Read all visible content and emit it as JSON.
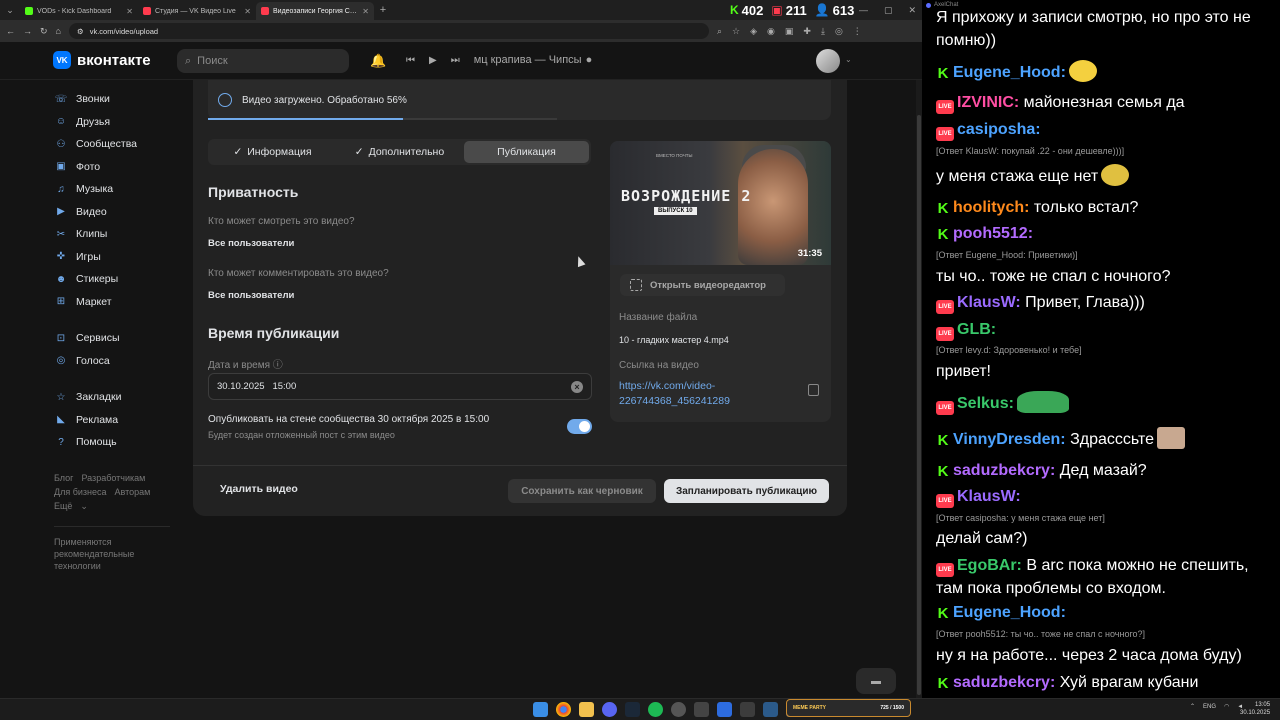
{
  "browser": {
    "tabs": [
      {
        "label": "VODs - Kick Dashboard",
        "color": "#53fc18"
      },
      {
        "label": "Студия — VK Видео Live",
        "color": "#ff3b4e"
      },
      {
        "label": "Видеозаписи Георгия Смида",
        "color": "#ff3b4e"
      }
    ],
    "url": "vk.com/video/upload"
  },
  "stream_stats": {
    "kick_viewers": "402",
    "live_viewers": "211",
    "total": "613"
  },
  "vk": {
    "logo": "вконтакте",
    "logo_badge": "VK",
    "search_placeholder": "Поиск",
    "now_playing": "мц крапива — Чипсы"
  },
  "sidebar": {
    "group1": [
      "Звонки",
      "Друзья",
      "Сообщества",
      "Фото",
      "Музыка",
      "Видео",
      "Клипы",
      "Игры",
      "Стикеры",
      "Маркет"
    ],
    "group2": [
      "Сервисы",
      "Голоса"
    ],
    "group3": [
      "Закладки",
      "Реклама",
      "Помощь"
    ],
    "footer": {
      "blog": "Блог",
      "devs": "Разработчикам",
      "business": "Для бизнеса",
      "authors": "Авторам",
      "more": "Ещё"
    },
    "recommend_note": "Применяются рекомендательные технологии"
  },
  "upload": {
    "status": "Видео загружено. Обработано 56%",
    "progress_percent": 56,
    "tabs": [
      "Информация",
      "Дополнительно",
      "Публикация"
    ]
  },
  "privacy": {
    "heading": "Приватность",
    "who_watch_label": "Кто может смотреть это видео?",
    "who_watch_value": "Все пользователи",
    "who_comment_label": "Кто может комментировать это видео?",
    "who_comment_value": "Все пользователи"
  },
  "publish_time": {
    "heading": "Время публикации",
    "datetime_label": "Дата и время",
    "datetime_value": "30.10.2025   15:00",
    "wall_post": "Опубликовать на стене сообщества 30 октября 2025 в 15:00",
    "wall_post_sub": "Будет создан отложенный пост с этим видео",
    "wall_toggle_on": true
  },
  "preview": {
    "thumb_title": "ВОЗРОЖДЕНИЕ 2",
    "thumb_episode": "ВЫПУСК 10",
    "thumb_brand": "ВМЕСТО ПОЧТЫ",
    "duration": "31:35",
    "editor_button": "Открыть видеоредактор",
    "filename_label": "Название файла",
    "filename": "10 - гладких мастер 4.mp4",
    "link_label": "Ссылка на видео",
    "link_line1": "https://vk.com/video-",
    "link_line2": "226744368_456241289"
  },
  "actions": {
    "delete": "Удалить видео",
    "draft": "Сохранить как черновик",
    "schedule": "Запланировать публикацию"
  },
  "chat": {
    "app_title": "AxelChat",
    "messages": [
      {
        "platform": "",
        "nick": "",
        "color": "",
        "text": "Я прихожу и записи смотрю, но про это не помню))"
      },
      {
        "platform": "kick",
        "nick": "Eugene_Hood:",
        "color": "#4da3ff",
        "text": ""
      },
      {
        "platform": "live",
        "nick": "IZVINIC:",
        "color": "#ff4ea3",
        "text": "майонезная семья да"
      },
      {
        "platform": "live",
        "nick": "casiposha:",
        "color": "#4da3ff",
        "reply": "[Ответ KlausW: покупай .22 - они дешевле)))]",
        "text": "у меня стажа еще нет"
      },
      {
        "platform": "kick",
        "nick": "hoolitych:",
        "color": "#ff8a1c",
        "text": "только встал?"
      },
      {
        "platform": "kick",
        "nick": "pooh5512:",
        "color": "#b36bff",
        "reply": "[Ответ Eugene_Hood: Приветики)]",
        "text": "ты чо.. тоже не спал с ночного?"
      },
      {
        "platform": "live",
        "nick": "KlausW:",
        "color": "#9b6bff",
        "text": "Привет, Глава)))"
      },
      {
        "platform": "live",
        "nick": "GLB:",
        "color": "#39c86a",
        "reply": "[Ответ levy.d: Здоровенько! и тебе]",
        "text": "привет!"
      },
      {
        "platform": "live",
        "nick": "Selkus:",
        "color": "#39c86a",
        "text": ""
      },
      {
        "platform": "kick",
        "nick": "VinnyDresden:",
        "color": "#4da3ff",
        "text": "Здрасссьте"
      },
      {
        "platform": "kick",
        "nick": "saduzbekcry:",
        "color": "#b36bff",
        "text": "Дед мазай?"
      },
      {
        "platform": "live",
        "nick": "KlausW:",
        "color": "#9b6bff",
        "reply": "[Ответ casiposha: у меня стажа еще нет]",
        "text": "делай сам?)"
      },
      {
        "platform": "live",
        "nick": "EgoBAr:",
        "color": "#39c86a",
        "text": "В arc пока можно не спешить, там пока проблемы со входом."
      },
      {
        "platform": "kick",
        "nick": "Eugene_Hood:",
        "color": "#4da3ff",
        "reply": "[Ответ pooh5512: ты чо.. тоже не спал с ночного?]",
        "text": "ну я на работе... через 2 часа дома буду)"
      },
      {
        "platform": "kick",
        "nick": "saduzbekcry:",
        "color": "#b36bff",
        "text": "Хуй врагам кубани"
      }
    ]
  },
  "taskbar": {
    "widget_title": "MEME PARTY",
    "widget_value": "725 / 1500",
    "lang": "ENG",
    "time": "13:05",
    "date": "30.10.2025"
  }
}
